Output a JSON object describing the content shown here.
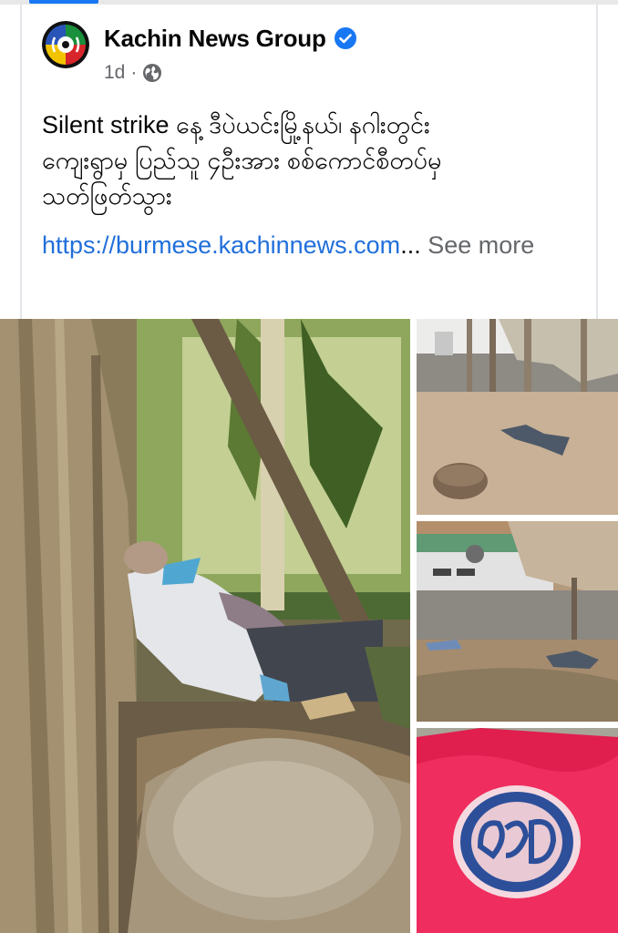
{
  "post": {
    "page_name": "Kachin News Group",
    "verified_icon": "verified-badge-icon",
    "time": "1d",
    "separator": "·",
    "audience_icon": "globe-icon",
    "text_lines": [
      "Silent strike နေ့ ဒီပဲယင်းမြို့နယ်၊ နဂါးတွင်း",
      "ကျေးရွာမှ ပြည်သူ ၄ဦးအား စစ်ကောင်စီတပ်မှ",
      "သတ်ဖြတ်သွား"
    ],
    "link": "https://burmese.kachinnews.com",
    "ellipsis": "...",
    "see_more": "See more"
  },
  "colors": {
    "link": "#216fdb",
    "muted": "#65676b",
    "verified": "#1877f2",
    "accent": "#1877f2"
  },
  "photos": [
    {
      "name": "photo-main-forest",
      "kind": "photograph"
    },
    {
      "name": "photo-courtyard-body",
      "kind": "photograph"
    },
    {
      "name": "photo-yard-building",
      "kind": "photograph"
    },
    {
      "name": "photo-red-cloth-logo",
      "kind": "photograph"
    }
  ]
}
